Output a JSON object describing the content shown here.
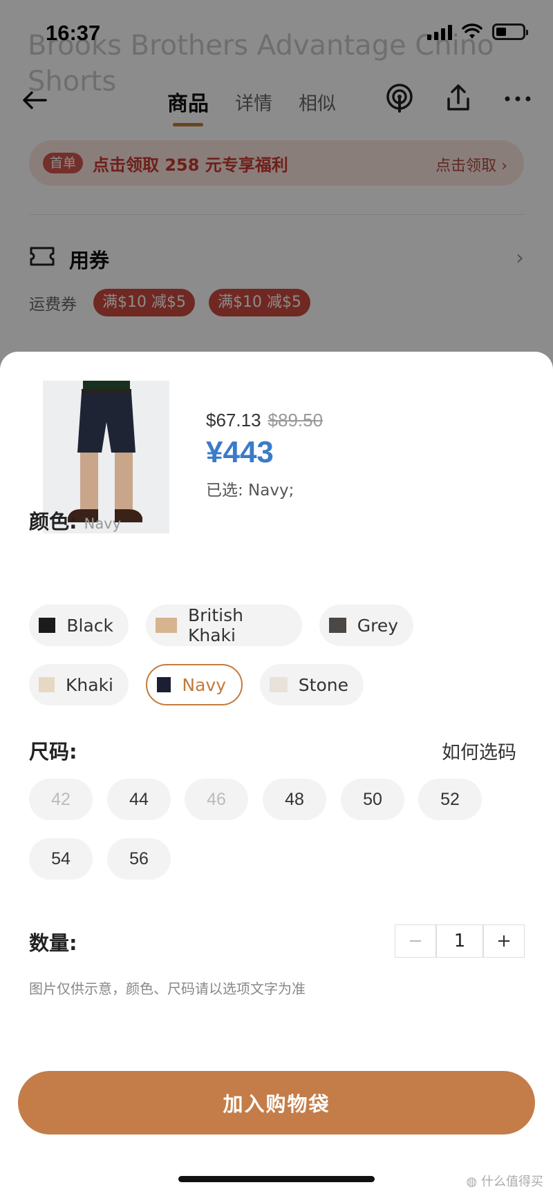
{
  "status_bar": {
    "time": "16:37",
    "battery_level": 0.4
  },
  "nav": {
    "tabs": [
      {
        "label": "商品",
        "active": true
      },
      {
        "label": "详情",
        "active": false
      },
      {
        "label": "相似",
        "active": false
      }
    ],
    "icons": [
      "back-arrow-icon",
      "podcast-icon",
      "share-icon",
      "more-icon"
    ]
  },
  "promo": {
    "badge": "首单",
    "text": "点击领取 258 元专享福利",
    "action": "点击领取",
    "colors": {
      "badge": "#d2574e",
      "text": "#c83a2f"
    }
  },
  "coupons": {
    "title": "用券",
    "label": "运费券",
    "tags": [
      "满$10 减$5",
      "满$10 减$5"
    ]
  },
  "product": {
    "price_usd": "$67.13",
    "price_old": "$89.50",
    "price_cny": "¥443",
    "selected": "已选: Navy;"
  },
  "color_section": {
    "title": "颜色:",
    "current": "Navy",
    "options": [
      {
        "label": "Black",
        "swatch": "#1b1b1b",
        "active": false
      },
      {
        "label": "British Khaki",
        "swatch": "#d6b48e",
        "active": false
      },
      {
        "label": "Grey",
        "swatch": "#4a4744",
        "active": false
      },
      {
        "label": "Khaki",
        "swatch": "#e6d8c2",
        "active": false
      },
      {
        "label": "Navy",
        "swatch": "#1c1e33",
        "active": true
      },
      {
        "label": "Stone",
        "swatch": "#e8e2da",
        "active": false
      }
    ]
  },
  "size_section": {
    "title": "尺码:",
    "guide": "如何选码",
    "options": [
      {
        "label": "42",
        "available": false
      },
      {
        "label": "44",
        "available": true
      },
      {
        "label": "46",
        "available": false
      },
      {
        "label": "48",
        "available": true
      },
      {
        "label": "50",
        "available": true
      },
      {
        "label": "52",
        "available": true
      },
      {
        "label": "54",
        "available": true
      },
      {
        "label": "56",
        "available": true
      }
    ]
  },
  "quantity": {
    "label": "数量:",
    "value": "1",
    "minus": "−",
    "plus": "+"
  },
  "note": "图片仅供示意，颜色、尺码请以选项文字为准",
  "cta": {
    "label": "加入购物袋",
    "color": "#c47d48"
  },
  "accent_color": "#c47a3c",
  "watermark": "什么值得买"
}
